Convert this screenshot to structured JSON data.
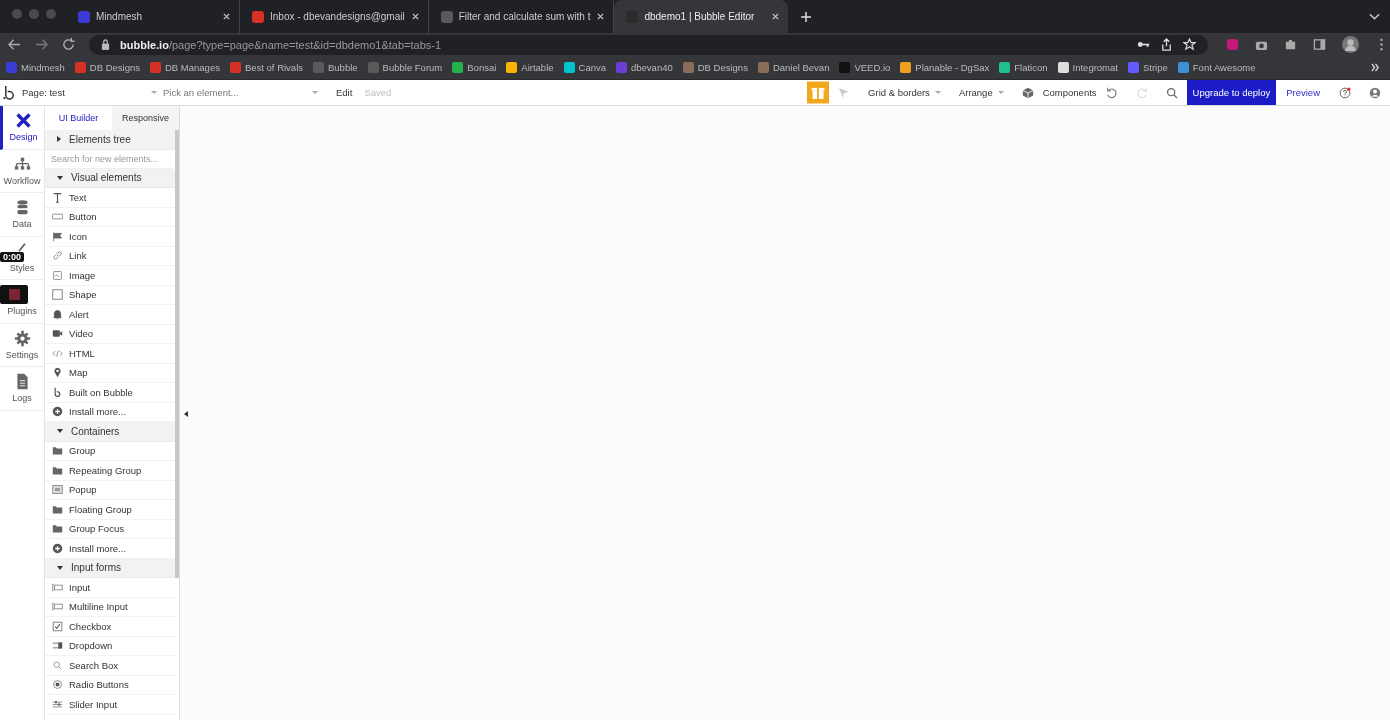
{
  "browser_tabs": [
    {
      "title": "Mindmesh",
      "selected": false,
      "color": "#3b3bd6"
    },
    {
      "title": "Inbox - dbevandesigns@gmail",
      "selected": false,
      "color": "#d93025"
    },
    {
      "title": "Filter and calculate sum with t",
      "selected": false,
      "color": "#5a5a5a"
    },
    {
      "title": "dbdemo1 | Bubble Editor",
      "selected": true,
      "color": "#2b2b2b"
    }
  ],
  "address": {
    "host": "bubble.io",
    "path": "/page?type=page&name=test&id=dbdemo1&tab=tabs-1"
  },
  "bookmarks": [
    {
      "label": "Mindmesh",
      "color": "#3b3bd6"
    },
    {
      "label": "DB Designs",
      "color": "#d93025"
    },
    {
      "label": "DB Manages",
      "color": "#d93025"
    },
    {
      "label": "Best of Rivals",
      "color": "#d93025"
    },
    {
      "label": "Bubble",
      "color": "#5a5a5a"
    },
    {
      "label": "Bubble Forum",
      "color": "#5a5a5a"
    },
    {
      "label": "Bonsai",
      "color": "#22b14c"
    },
    {
      "label": "Airtable",
      "color": "#fcb400"
    },
    {
      "label": "Canva",
      "color": "#00c4cc"
    },
    {
      "label": "dbevan40",
      "color": "#6b3fd6"
    },
    {
      "label": "DB Designs",
      "color": "#8a6d5a"
    },
    {
      "label": "Daniel Bevan",
      "color": "#8a6d5a"
    },
    {
      "label": "VEED.io",
      "color": "#111111"
    },
    {
      "label": "Planable - DgSax",
      "color": "#f0a020"
    },
    {
      "label": "Flaticon",
      "color": "#1fbf8f"
    },
    {
      "label": "Integromat",
      "color": "#dddddd"
    },
    {
      "label": "Stripe",
      "color": "#635bff"
    },
    {
      "label": "Font Awesome",
      "color": "#3d8fd6"
    }
  ],
  "editor_toolbar": {
    "page": "Page: test",
    "element_placeholder": "Pick an element...",
    "edit": "Edit",
    "status": "Saved",
    "grid": "Grid & borders",
    "arrange": "Arrange",
    "components": "Components",
    "upgrade": "Upgrade to deploy",
    "preview": "Preview"
  },
  "nav": [
    {
      "label": "Design",
      "kind": "design",
      "selected": true
    },
    {
      "label": "Workflow",
      "kind": "workflow",
      "selected": false
    },
    {
      "label": "Data",
      "kind": "data",
      "selected": false
    },
    {
      "label": "Styles",
      "kind": "styles",
      "selected": false
    },
    {
      "label": "Plugins",
      "kind": "plugins",
      "selected": false
    },
    {
      "label": "Settings",
      "kind": "settings",
      "selected": false
    },
    {
      "label": "Logs",
      "kind": "logs",
      "selected": false
    }
  ],
  "recorder": {
    "time": "0:00"
  },
  "panel_tabs": [
    {
      "label": "UI Builder",
      "selected": true
    },
    {
      "label": "Responsive",
      "selected": false
    }
  ],
  "elements_tree": {
    "label": "Elements tree",
    "expanded": false
  },
  "search": {
    "placeholder": "Search for new elements..."
  },
  "sections": [
    {
      "title": "Visual elements",
      "expanded": true,
      "items": [
        {
          "label": "Text",
          "kind": "text"
        },
        {
          "label": "Button",
          "kind": "button"
        },
        {
          "label": "Icon",
          "kind": "flag"
        },
        {
          "label": "Link",
          "kind": "link"
        },
        {
          "label": "Image",
          "kind": "image"
        },
        {
          "label": "Shape",
          "kind": "shape"
        },
        {
          "label": "Alert",
          "kind": "bell"
        },
        {
          "label": "Video",
          "kind": "video"
        },
        {
          "label": "HTML",
          "kind": "code"
        },
        {
          "label": "Map",
          "kind": "pin"
        },
        {
          "label": "Built on Bubble",
          "kind": "bubble"
        },
        {
          "label": "Install more...",
          "kind": "plus"
        }
      ]
    },
    {
      "title": "Containers",
      "expanded": true,
      "items": [
        {
          "label": "Group",
          "kind": "folder"
        },
        {
          "label": "Repeating Group",
          "kind": "folder"
        },
        {
          "label": "Popup",
          "kind": "popup"
        },
        {
          "label": "Floating Group",
          "kind": "folder"
        },
        {
          "label": "Group Focus",
          "kind": "folder"
        },
        {
          "label": "Install more...",
          "kind": "plus"
        }
      ]
    },
    {
      "title": "Input forms",
      "expanded": true,
      "items": [
        {
          "label": "Input",
          "kind": "input"
        },
        {
          "label": "Multiline Input",
          "kind": "input"
        },
        {
          "label": "Checkbox",
          "kind": "checkbox"
        },
        {
          "label": "Dropdown",
          "kind": "dropdown"
        },
        {
          "label": "Search Box",
          "kind": "search"
        },
        {
          "label": "Radio Buttons",
          "kind": "radio"
        },
        {
          "label": "Slider Input",
          "kind": "slider"
        }
      ]
    }
  ]
}
